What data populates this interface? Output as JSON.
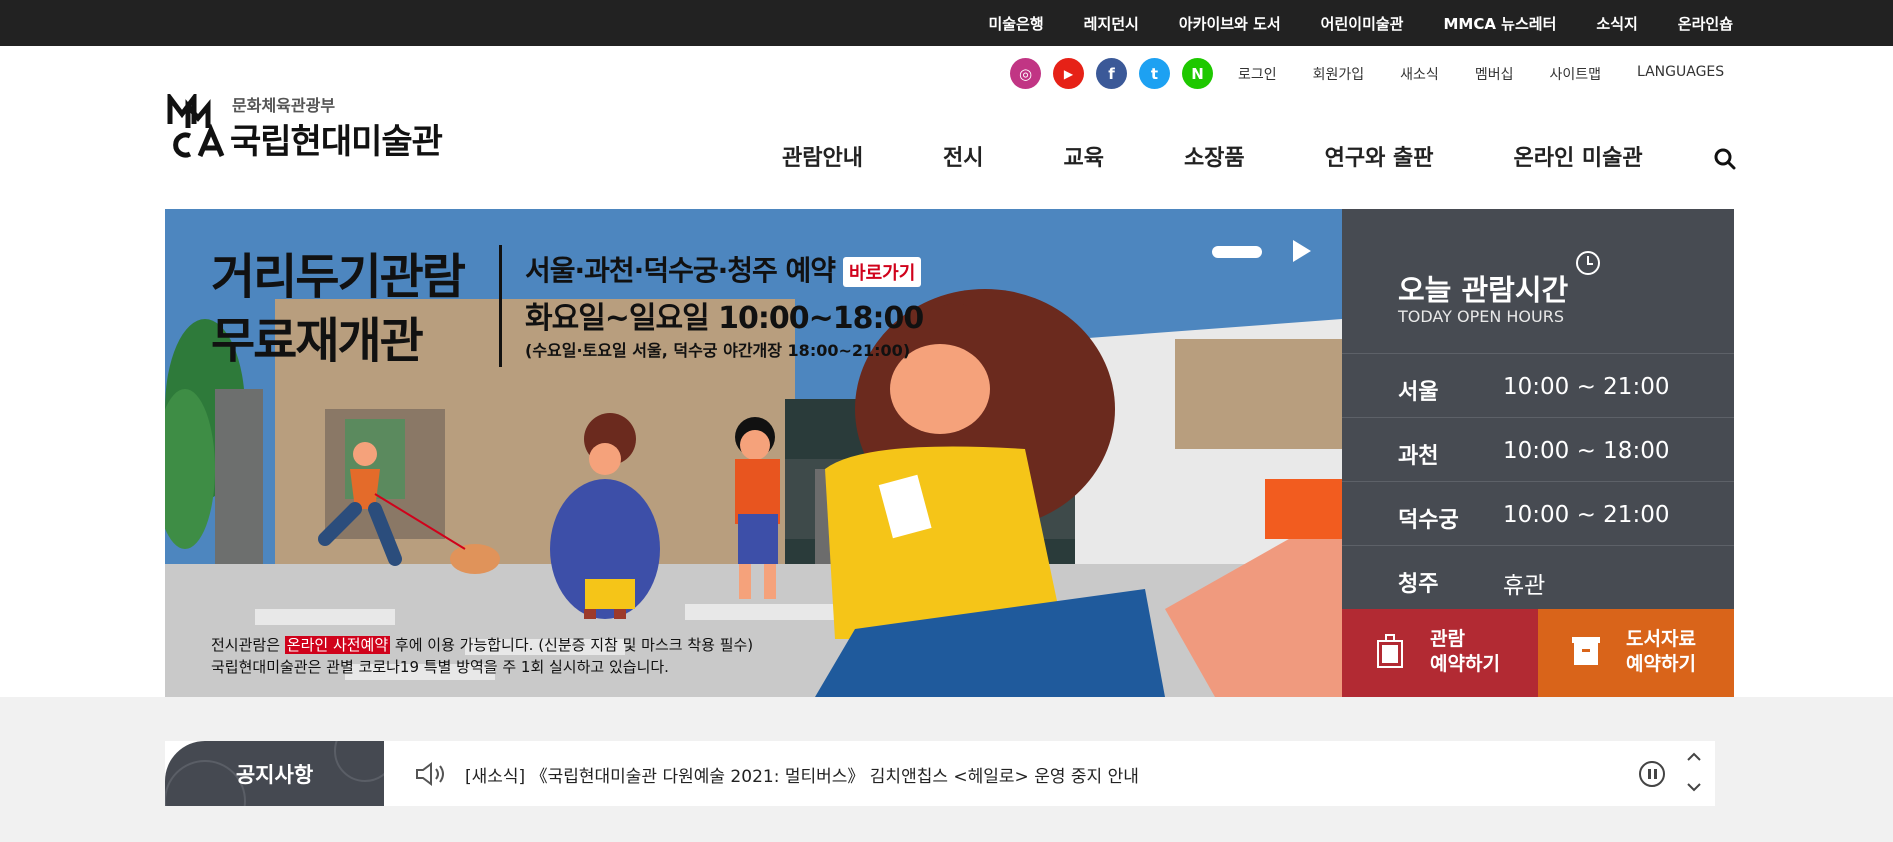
{
  "topbar": {
    "items": [
      "미술은행",
      "레지던시",
      "아카이브와 도서",
      "어린이미술관",
      "MMCA 뉴스레터",
      "소식지",
      "온라인숍"
    ]
  },
  "logo": {
    "ministry": "문화체육관광부",
    "name": "국립현대미술관"
  },
  "social": [
    {
      "icon": "instagram-icon",
      "color": "#c13584",
      "glyph": "◎"
    },
    {
      "icon": "youtube-icon",
      "color": "#e62117",
      "glyph": "▶"
    },
    {
      "icon": "facebook-icon",
      "color": "#3b5998",
      "glyph": "f"
    },
    {
      "icon": "twitter-icon",
      "color": "#1da1f2",
      "glyph": "t"
    },
    {
      "icon": "naver-icon",
      "color": "#1ec800",
      "glyph": "N"
    }
  ],
  "util": [
    "로그인",
    "회원가입",
    "새소식",
    "멤버십",
    "사이트맵",
    "LANGUAGES"
  ],
  "gnb": [
    "관람안내",
    "전시",
    "교육",
    "소장품",
    "연구와 출판",
    "온라인 미술관"
  ],
  "hero": {
    "title_line1": "거리두기관람",
    "title_line2": "무료재개관",
    "sub1": "서울·과천·덕수궁·청주 예약",
    "badge": "바로가기",
    "sub2": "화요일~일요일 10:00~18:00",
    "sub3": "(수요일·토요일 서울, 덕수궁 야간개장 18:00~21:00)",
    "note1_pre": "전시관람은 ",
    "note1_hl": "온라인 사전예약",
    "note1_post": " 후에 이용 가능합니다. (신분증 지참 및 마스크 착용 필수)",
    "note2": "국립현대미술관은 관별 코로나19 특별 방역을 주 1회 실시하고 있습니다.",
    "sign_mark": "MMCA",
    "sign_text": "국립현대미술관"
  },
  "hours": {
    "title": "오늘 관람시간",
    "eng": "TODAY OPEN HOURS",
    "rows": [
      {
        "loc": "서울",
        "time": "10:00 ~ 21:00"
      },
      {
        "loc": "과천",
        "time": "10:00 ~ 18:00"
      },
      {
        "loc": "덕수궁",
        "time": "10:00 ~ 21:00"
      },
      {
        "loc": "청주",
        "time": "휴관"
      }
    ]
  },
  "booking": {
    "visit_line1": "관람",
    "visit_line2": "예약하기",
    "library_line1": "도서자료",
    "library_line2": "예약하기"
  },
  "notice": {
    "label": "공지사항",
    "text": "[새소식] 《국립현대미술관 다원예술 2021: 멀티버스》 김치앤칩스 <헤일로> 운영 중지 안내"
  },
  "colors": {
    "topbar": "#222222",
    "panel": "#474b52",
    "visit": "#b22a33",
    "library": "#d9641a",
    "highlight": "#d0021b"
  }
}
